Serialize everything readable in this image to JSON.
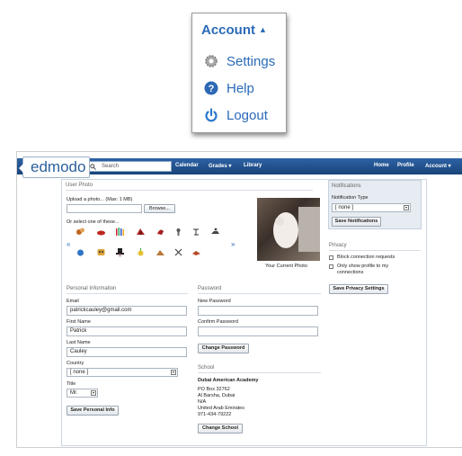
{
  "popup": {
    "title": "Account",
    "items": [
      {
        "label": "Settings",
        "icon": "gear-icon"
      },
      {
        "label": "Help",
        "icon": "help-icon"
      },
      {
        "label": "Logout",
        "icon": "power-icon"
      }
    ]
  },
  "topbar": {
    "logo": "edmodo",
    "search_placeholder": "Search",
    "nav_left": [
      "Calendar",
      "Grades ▾",
      "Library"
    ],
    "nav_right": [
      "Home",
      "Profile",
      "Account ▾"
    ]
  },
  "photo": {
    "section": "User Photo",
    "upload_label": "Upload a photo... (Max: 1 MB)",
    "browse": "Browse...",
    "select_label": "Or select one of these...",
    "current_caption": "Your Current Photo",
    "prev": "«",
    "next": "»"
  },
  "personal": {
    "section": "Personal Information",
    "email_label": "Email",
    "email": "patrickcauley@gmail.com",
    "first_label": "First Name",
    "first": "Patrick",
    "last_label": "Last Name",
    "last": "Cauley",
    "country_label": "Country",
    "country": "[ none ]",
    "title_label": "Title",
    "title": "Mr.",
    "save": "Save Personal Info"
  },
  "password": {
    "section": "Password",
    "new_label": "New Password",
    "confirm_label": "Confirm Password",
    "change": "Change Password"
  },
  "school": {
    "section": "School",
    "name": "Dubai American Academy",
    "lines": [
      "PO Box 32762",
      "Al Barsha, Dubai",
      "N/A",
      "United Arab Emirates",
      "971-434-79222"
    ],
    "change": "Change School"
  },
  "notifications": {
    "section": "Notifications",
    "type_label": "Notification Type",
    "type": "[ none ]",
    "save": "Save Notifications"
  },
  "privacy": {
    "section": "Privacy",
    "block": "Block connection requests",
    "only_show_1": "Only show profile to my",
    "only_show_2": "connections",
    "save": "Save Privacy Settings"
  },
  "colors": {
    "accent": "#2a6ab8",
    "topbar": "#1c4e8c"
  }
}
